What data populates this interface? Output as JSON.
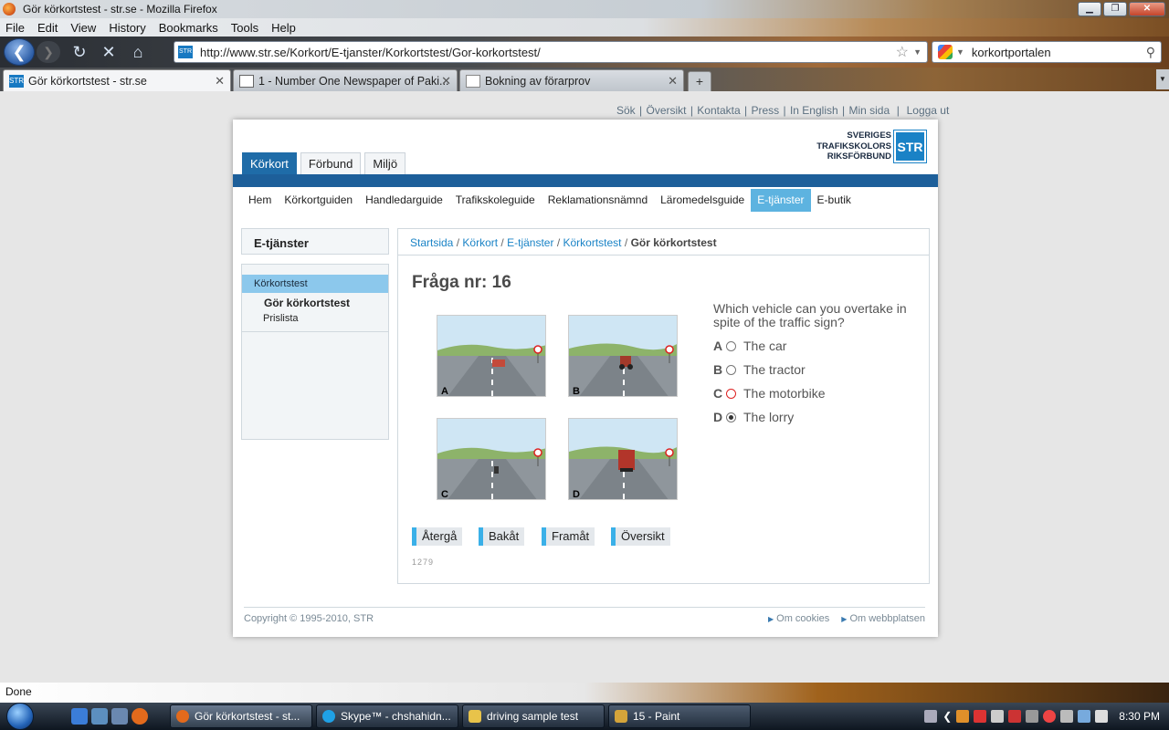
{
  "window": {
    "title": "Gör körkortstest - str.se - Mozilla Firefox"
  },
  "menu": [
    "File",
    "Edit",
    "View",
    "History",
    "Bookmarks",
    "Tools",
    "Help"
  ],
  "url": "http://www.str.se/Korkort/E-tjanster/Korkortstest/Gor-korkortstest/",
  "search": {
    "value": "korkortportalen"
  },
  "tabs": [
    {
      "label": "Gör körkortstest - str.se",
      "active": true
    },
    {
      "label": "1 - Number One Newspaper of Paki..."
    },
    {
      "label": "Bokning av förarprov"
    }
  ],
  "site": {
    "toplinks": [
      "Sök",
      "Översikt",
      "Kontakta",
      "Press",
      "In English",
      "Min sida",
      "Logga ut"
    ],
    "logo": {
      "line1": "SVERIGES",
      "line2": "TRAFIKSKOLORS",
      "line3": "RIKSFÖRBUND",
      "mark": "STR"
    },
    "maintabs": [
      "Körkort",
      "Förbund",
      "Miljö"
    ],
    "subnav": [
      "Hem",
      "Körkortguiden",
      "Handledarguide",
      "Trafikskoleguide",
      "Reklamationsnämnd",
      "Läromedelsguide",
      "E-tjänster",
      "E-butik"
    ],
    "sidebar": {
      "header": "E-tjänster",
      "selected": "Körkortstest",
      "item1": "Gör körkortstest",
      "item2": "Prislista"
    },
    "breadcrumb": {
      "b1": "Startsida",
      "b2": "Körkort",
      "b3": "E-tjänster",
      "b4": "Körkortstest",
      "current": "Gör körkortstest"
    },
    "question": {
      "title": "Fråga nr: 16",
      "text": "Which vehicle can you overtake in spite of the traffic sign?",
      "images": [
        "A",
        "B",
        "C",
        "D"
      ],
      "options": [
        {
          "letter": "A",
          "label": "The car",
          "selected": false
        },
        {
          "letter": "B",
          "label": "The tractor",
          "selected": false
        },
        {
          "letter": "C",
          "label": "The motorbike",
          "selected": false
        },
        {
          "letter": "D",
          "label": "The lorry",
          "selected": true
        }
      ],
      "buttons": [
        "Återgå",
        "Bakåt",
        "Framåt",
        "Översikt"
      ],
      "code": "1279"
    },
    "footer": {
      "copyright": "Copyright © 1995-2010, STR",
      "link1": "Om cookies",
      "link2": "Om webbplatsen"
    }
  },
  "status": "Done",
  "taskbar": {
    "items": [
      "Gör körkortstest - st...",
      "Skype™ - chshahidn...",
      "driving sample test",
      "15 - Paint"
    ],
    "clock": "8:30 PM"
  },
  "colors": {
    "accent": "#1d5f9a",
    "highlight": "#5db3e0",
    "link": "#1a83c6",
    "button_bar": "#3ab0e8"
  }
}
